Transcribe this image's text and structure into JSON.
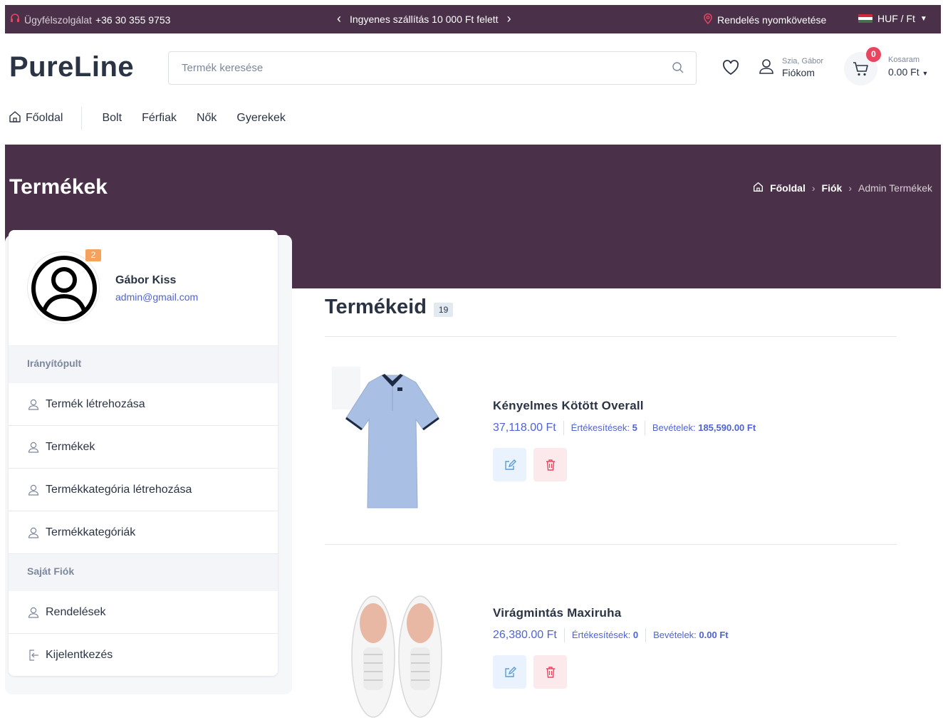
{
  "topbar": {
    "support_label": "Ügyfélszolgálat",
    "support_phone": "+36 30 355 9753",
    "promo": "Ingyenes szállítás 10 000 Ft felett",
    "tracking": "Rendelés nyomkövetése",
    "currency": "HUF / Ft"
  },
  "header": {
    "logo": "PureLine",
    "search_placeholder": "Termék keresése",
    "greeting": "Szia, Gábor",
    "account_label": "Fiókom",
    "cart_count": "0",
    "cart_label": "Kosaram",
    "cart_total": "0.00 Ft"
  },
  "nav": {
    "home": "Főoldal",
    "items": [
      "Bolt",
      "Férfiak",
      "Nők",
      "Gyerekek"
    ]
  },
  "banner": {
    "title": "Termékek",
    "breadcrumb": [
      "Főoldal",
      "Fiók",
      "Admin Termékek"
    ]
  },
  "sidebar": {
    "badge": "2",
    "name": "Gábor Kiss",
    "email": "admin@gmail.com",
    "section_dashboard": "Irányítópult",
    "dashboard_items": [
      "Termék létrehozása",
      "Termékek",
      "Termékkategória létrehozása",
      "Termékkategóriák"
    ],
    "section_account": "Saját Fiók",
    "orders": "Rendelések",
    "logout": "Kijelentkezés"
  },
  "content": {
    "title": "Termékeid",
    "count": "19",
    "sales_label": "Értékesítések:",
    "revenue_label": "Bevételek:",
    "products": [
      {
        "name": "Kényelmes Kötött Overall",
        "price": "37,118.00 Ft",
        "sales": "5",
        "revenue": "185,590.00 Ft"
      },
      {
        "name": "Virágmintás Maxiruha",
        "price": "26,380.00 Ft",
        "sales": "0",
        "revenue": "0.00 Ft"
      }
    ]
  },
  "colors": {
    "brand_dark": "#4a3149",
    "accent_blue": "#4e63d6",
    "badge_red": "#e94560",
    "badge_orange": "#f5a25d"
  },
  "icons": [
    "headset-icon",
    "chevron-left-icon",
    "chevron-right-icon",
    "location-pin-icon",
    "flag-icon",
    "caret-down-icon",
    "search-icon",
    "heart-icon",
    "user-icon",
    "cart-icon",
    "home-icon",
    "avatar-icon",
    "edit-icon",
    "trash-icon",
    "logout-icon"
  ]
}
